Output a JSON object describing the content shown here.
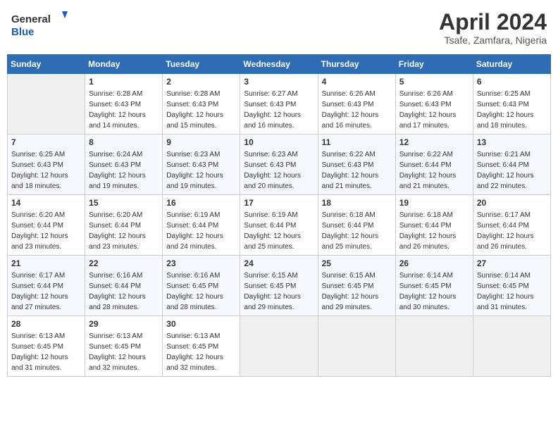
{
  "header": {
    "logo_general": "General",
    "logo_blue": "Blue",
    "month_title": "April 2024",
    "location": "Tsafe, Zamfara, Nigeria"
  },
  "weekdays": [
    "Sunday",
    "Monday",
    "Tuesday",
    "Wednesday",
    "Thursday",
    "Friday",
    "Saturday"
  ],
  "weeks": [
    [
      {
        "day": "",
        "info": ""
      },
      {
        "day": "1",
        "info": "Sunrise: 6:28 AM\nSunset: 6:43 PM\nDaylight: 12 hours\nand 14 minutes."
      },
      {
        "day": "2",
        "info": "Sunrise: 6:28 AM\nSunset: 6:43 PM\nDaylight: 12 hours\nand 15 minutes."
      },
      {
        "day": "3",
        "info": "Sunrise: 6:27 AM\nSunset: 6:43 PM\nDaylight: 12 hours\nand 16 minutes."
      },
      {
        "day": "4",
        "info": "Sunrise: 6:26 AM\nSunset: 6:43 PM\nDaylight: 12 hours\nand 16 minutes."
      },
      {
        "day": "5",
        "info": "Sunrise: 6:26 AM\nSunset: 6:43 PM\nDaylight: 12 hours\nand 17 minutes."
      },
      {
        "day": "6",
        "info": "Sunrise: 6:25 AM\nSunset: 6:43 PM\nDaylight: 12 hours\nand 18 minutes."
      }
    ],
    [
      {
        "day": "7",
        "info": "Sunrise: 6:25 AM\nSunset: 6:43 PM\nDaylight: 12 hours\nand 18 minutes."
      },
      {
        "day": "8",
        "info": "Sunrise: 6:24 AM\nSunset: 6:43 PM\nDaylight: 12 hours\nand 19 minutes."
      },
      {
        "day": "9",
        "info": "Sunrise: 6:23 AM\nSunset: 6:43 PM\nDaylight: 12 hours\nand 19 minutes."
      },
      {
        "day": "10",
        "info": "Sunrise: 6:23 AM\nSunset: 6:43 PM\nDaylight: 12 hours\nand 20 minutes."
      },
      {
        "day": "11",
        "info": "Sunrise: 6:22 AM\nSunset: 6:43 PM\nDaylight: 12 hours\nand 21 minutes."
      },
      {
        "day": "12",
        "info": "Sunrise: 6:22 AM\nSunset: 6:44 PM\nDaylight: 12 hours\nand 21 minutes."
      },
      {
        "day": "13",
        "info": "Sunrise: 6:21 AM\nSunset: 6:44 PM\nDaylight: 12 hours\nand 22 minutes."
      }
    ],
    [
      {
        "day": "14",
        "info": "Sunrise: 6:20 AM\nSunset: 6:44 PM\nDaylight: 12 hours\nand 23 minutes."
      },
      {
        "day": "15",
        "info": "Sunrise: 6:20 AM\nSunset: 6:44 PM\nDaylight: 12 hours\nand 23 minutes."
      },
      {
        "day": "16",
        "info": "Sunrise: 6:19 AM\nSunset: 6:44 PM\nDaylight: 12 hours\nand 24 minutes."
      },
      {
        "day": "17",
        "info": "Sunrise: 6:19 AM\nSunset: 6:44 PM\nDaylight: 12 hours\nand 25 minutes."
      },
      {
        "day": "18",
        "info": "Sunrise: 6:18 AM\nSunset: 6:44 PM\nDaylight: 12 hours\nand 25 minutes."
      },
      {
        "day": "19",
        "info": "Sunrise: 6:18 AM\nSunset: 6:44 PM\nDaylight: 12 hours\nand 26 minutes."
      },
      {
        "day": "20",
        "info": "Sunrise: 6:17 AM\nSunset: 6:44 PM\nDaylight: 12 hours\nand 26 minutes."
      }
    ],
    [
      {
        "day": "21",
        "info": "Sunrise: 6:17 AM\nSunset: 6:44 PM\nDaylight: 12 hours\nand 27 minutes."
      },
      {
        "day": "22",
        "info": "Sunrise: 6:16 AM\nSunset: 6:44 PM\nDaylight: 12 hours\nand 28 minutes."
      },
      {
        "day": "23",
        "info": "Sunrise: 6:16 AM\nSunset: 6:45 PM\nDaylight: 12 hours\nand 28 minutes."
      },
      {
        "day": "24",
        "info": "Sunrise: 6:15 AM\nSunset: 6:45 PM\nDaylight: 12 hours\nand 29 minutes."
      },
      {
        "day": "25",
        "info": "Sunrise: 6:15 AM\nSunset: 6:45 PM\nDaylight: 12 hours\nand 29 minutes."
      },
      {
        "day": "26",
        "info": "Sunrise: 6:14 AM\nSunset: 6:45 PM\nDaylight: 12 hours\nand 30 minutes."
      },
      {
        "day": "27",
        "info": "Sunrise: 6:14 AM\nSunset: 6:45 PM\nDaylight: 12 hours\nand 31 minutes."
      }
    ],
    [
      {
        "day": "28",
        "info": "Sunrise: 6:13 AM\nSunset: 6:45 PM\nDaylight: 12 hours\nand 31 minutes."
      },
      {
        "day": "29",
        "info": "Sunrise: 6:13 AM\nSunset: 6:45 PM\nDaylight: 12 hours\nand 32 minutes."
      },
      {
        "day": "30",
        "info": "Sunrise: 6:13 AM\nSunset: 6:45 PM\nDaylight: 12 hours\nand 32 minutes."
      },
      {
        "day": "",
        "info": ""
      },
      {
        "day": "",
        "info": ""
      },
      {
        "day": "",
        "info": ""
      },
      {
        "day": "",
        "info": ""
      }
    ]
  ]
}
